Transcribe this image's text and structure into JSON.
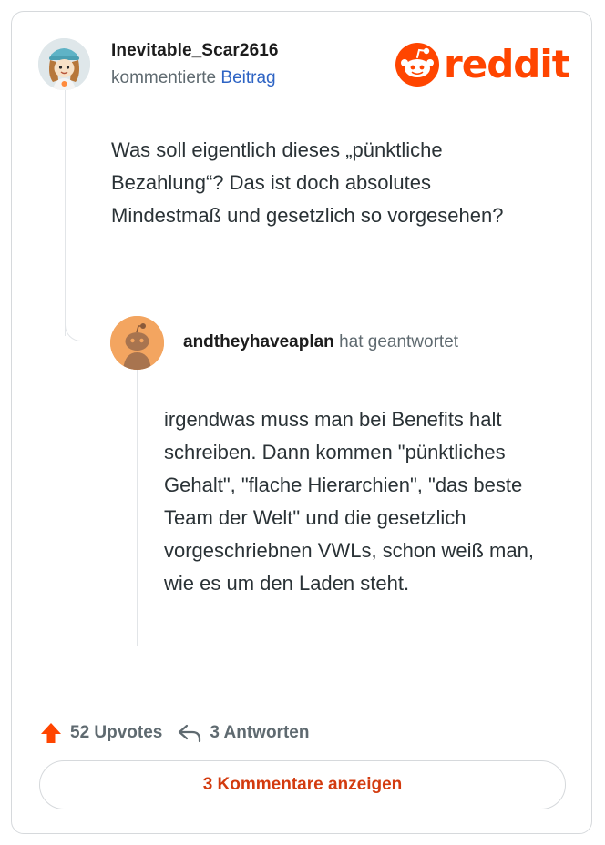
{
  "colors": {
    "brand": "#ff4500",
    "link": "#2e64c4",
    "cta": "#d33b0f",
    "text": "#2a3236",
    "muted": "#5f6a70"
  },
  "logo": {
    "icon": "reddit-snoo-icon",
    "text": "reddit"
  },
  "comment": {
    "username": "Inevitable_Scar2616",
    "action_prefix": "kommentierte",
    "action_link": "Beitrag",
    "body": "Was soll eigentlich dieses „pünktliche Bezahlung“? Das ist doch absolutes Mindestmaß und gesetzlich so vorgesehen?"
  },
  "reply": {
    "username": "andtheyhaveaplan",
    "action": "hat geantwortet",
    "body": "irgendwas muss man bei Benefits halt schreiben. Dann kommen \"pünktliches Gehalt\", \"flache Hierarchien\", \"das beste Team der Welt\" und die gesetzlich vorgeschriebnen VWLs, schon weiß man, wie es um den Laden steht."
  },
  "footer": {
    "upvote_icon": "upvote-arrow-icon",
    "upvotes": "52 Upvotes",
    "reply_icon": "reply-arrow-icon",
    "replies": "3 Antworten",
    "show_comments": "3 Kommentare anzeigen"
  }
}
